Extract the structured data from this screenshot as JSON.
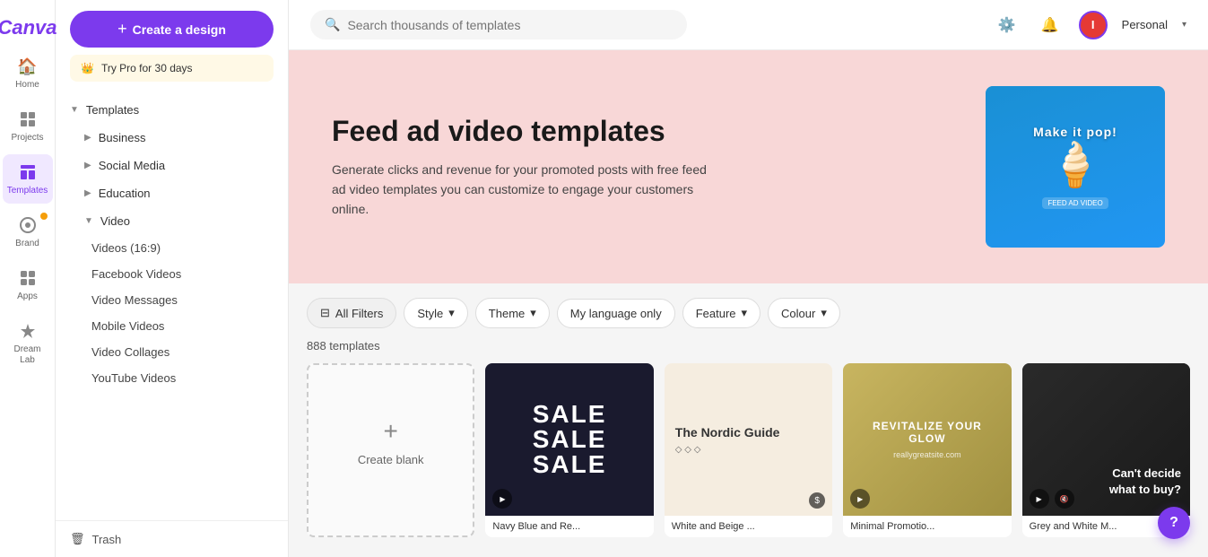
{
  "sidebar": {
    "items": [
      {
        "id": "home",
        "label": "Home",
        "icon": "⊞"
      },
      {
        "id": "projects",
        "label": "Projects",
        "icon": "📁"
      },
      {
        "id": "templates",
        "label": "Templates",
        "icon": "⊡",
        "active": true
      },
      {
        "id": "brand",
        "label": "Brand",
        "icon": "◈"
      },
      {
        "id": "apps",
        "label": "Apps",
        "icon": "⊞"
      },
      {
        "id": "dream-lab",
        "label": "Dream Lab",
        "icon": "✦"
      }
    ]
  },
  "panel": {
    "create_btn": "Create a design",
    "pro_label": "Try Pro for 30 days",
    "templates_label": "Templates",
    "nav": [
      {
        "id": "business",
        "label": "Business",
        "expanded": false
      },
      {
        "id": "social-media",
        "label": "Social Media",
        "expanded": false
      },
      {
        "id": "education",
        "label": "Education",
        "expanded": false
      },
      {
        "id": "video",
        "label": "Video",
        "expanded": true
      }
    ],
    "video_sub_items": [
      "Videos (16:9)",
      "Facebook Videos",
      "Video Messages",
      "Mobile Videos",
      "Video Collages",
      "YouTube Videos"
    ],
    "trash": "Trash"
  },
  "topbar": {
    "search_placeholder": "Search thousands of templates",
    "personal_label": "Personal"
  },
  "main": {
    "hero": {
      "title": "Feed ad video templates",
      "description": "Generate clicks and revenue for your promoted posts with free feed ad video templates you can customize to engage your customers online."
    },
    "filters": {
      "all_filters": "All Filters",
      "style": "Style",
      "theme": "Theme",
      "language": "My language only",
      "feature": "Feature",
      "colour": "Colour"
    },
    "templates_count": "888 templates",
    "templates": [
      {
        "id": "create-blank",
        "label": "Create blank",
        "type": "blank"
      },
      {
        "id": "navy-sale",
        "label": "Navy Blue and Re...",
        "type": "navy"
      },
      {
        "id": "nordic",
        "label": "White and Beige ...",
        "type": "nordic",
        "badge": "$"
      },
      {
        "id": "minimal",
        "label": "Minimal Promotio...",
        "type": "minimal"
      },
      {
        "id": "grey-white",
        "label": "Grey and White M...",
        "type": "grey"
      }
    ]
  },
  "help": {
    "label": "?"
  }
}
